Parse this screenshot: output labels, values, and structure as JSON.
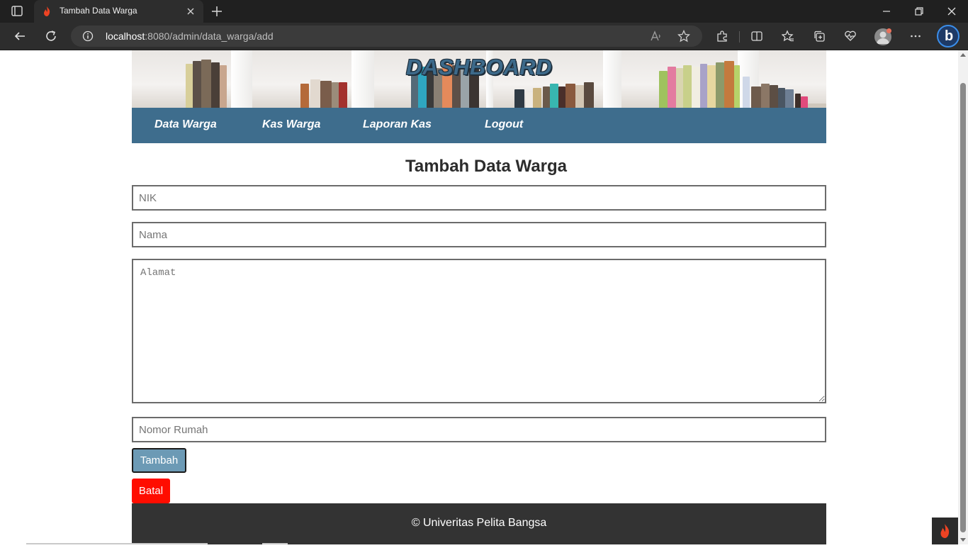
{
  "browser": {
    "tab_title": "Tambah Data Warga",
    "url_host": "localhost",
    "url_path": ":8080/admin/data_warga/add"
  },
  "header": {
    "banner_title": "DASHBOARD"
  },
  "nav": {
    "items": [
      {
        "label": "Data Warga"
      },
      {
        "label": "Kas Warga"
      },
      {
        "label": "Laporan Kas"
      },
      {
        "label": "Logout"
      }
    ]
  },
  "form": {
    "title": "Tambah Data Warga",
    "nik_placeholder": "NIK",
    "nama_placeholder": "Nama",
    "alamat_placeholder": "Alamat",
    "nomor_rumah_placeholder": "Nomor Rumah",
    "submit_label": "Tambah",
    "cancel_label": "Batal"
  },
  "footer": {
    "text": "© Univeritas Pelita Bangsa"
  },
  "colors": {
    "navbar": "#3e6d8d",
    "submit_button": "#6c9ab5",
    "cancel_button": "#ff0d00",
    "footer": "#333333"
  }
}
